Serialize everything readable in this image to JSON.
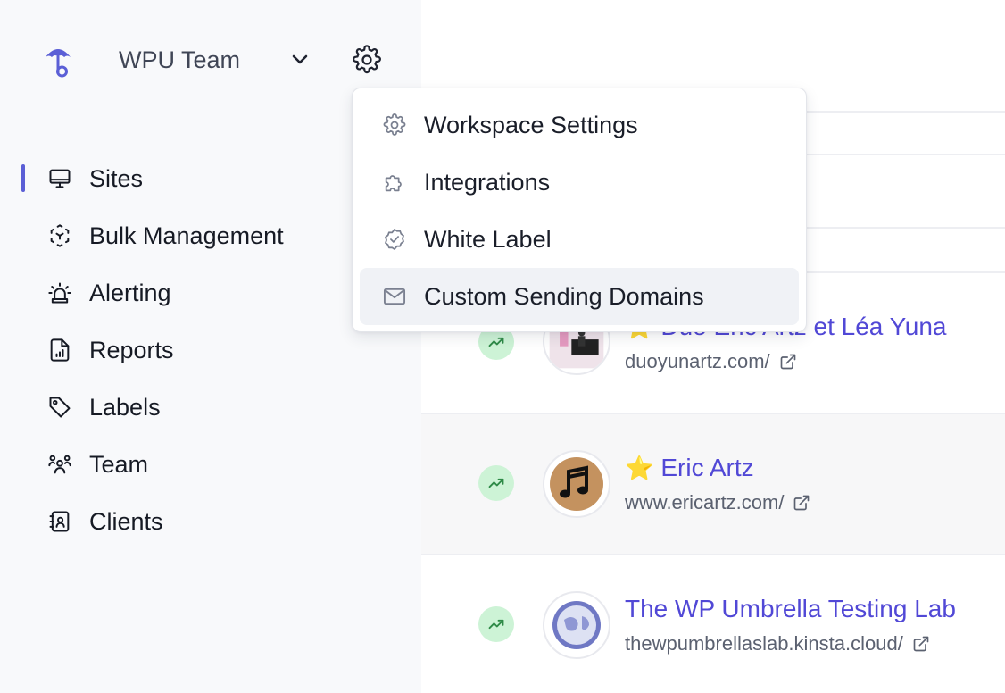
{
  "workspace": {
    "name": "WPU Team",
    "icons": {
      "logo": "umbrella-logo",
      "switch": "chevron-down-icon",
      "settings": "gear-icon"
    }
  },
  "nav": {
    "items": [
      {
        "label": "Sites",
        "icon": "monitor-icon",
        "active": true
      },
      {
        "label": "Bulk Management",
        "icon": "bulk-cube-icon"
      },
      {
        "label": "Alerting",
        "icon": "siren-icon"
      },
      {
        "label": "Reports",
        "icon": "report-file-icon"
      },
      {
        "label": "Labels",
        "icon": "tag-icon"
      },
      {
        "label": "Team",
        "icon": "team-icon"
      },
      {
        "label": "Clients",
        "icon": "contacts-book-icon"
      }
    ]
  },
  "dropdown": {
    "items": [
      {
        "label": "Workspace Settings",
        "icon": "gear-icon"
      },
      {
        "label": "Integrations",
        "icon": "puzzle-icon"
      },
      {
        "label": "White Label",
        "icon": "badge-check-icon"
      },
      {
        "label": "Custom Sending Domains",
        "icon": "mail-icon",
        "highlighted": true
      }
    ]
  },
  "sites": [
    {
      "name": "Duo Eric Artz et Léa Yuna",
      "url": "duoyunartz.com/",
      "favorite": true,
      "star": "⭐",
      "status_icon": "trending-up-icon"
    },
    {
      "name": "Eric Artz",
      "url": "www.ericartz.com/",
      "favorite": true,
      "star": "⭐",
      "status_icon": "trending-up-icon"
    },
    {
      "name": "The WP Umbrella Testing Lab",
      "url": "thewpumbrellaslab.kinsta.cloud/",
      "favorite": false,
      "status_icon": "trending-up-icon"
    }
  ],
  "colors": {
    "accent": "#5148d6",
    "active_bar": "#5b5fd6",
    "trend_bg": "#cdf3d6",
    "trend_fg": "#2e8a47",
    "star": "#f5c518"
  }
}
